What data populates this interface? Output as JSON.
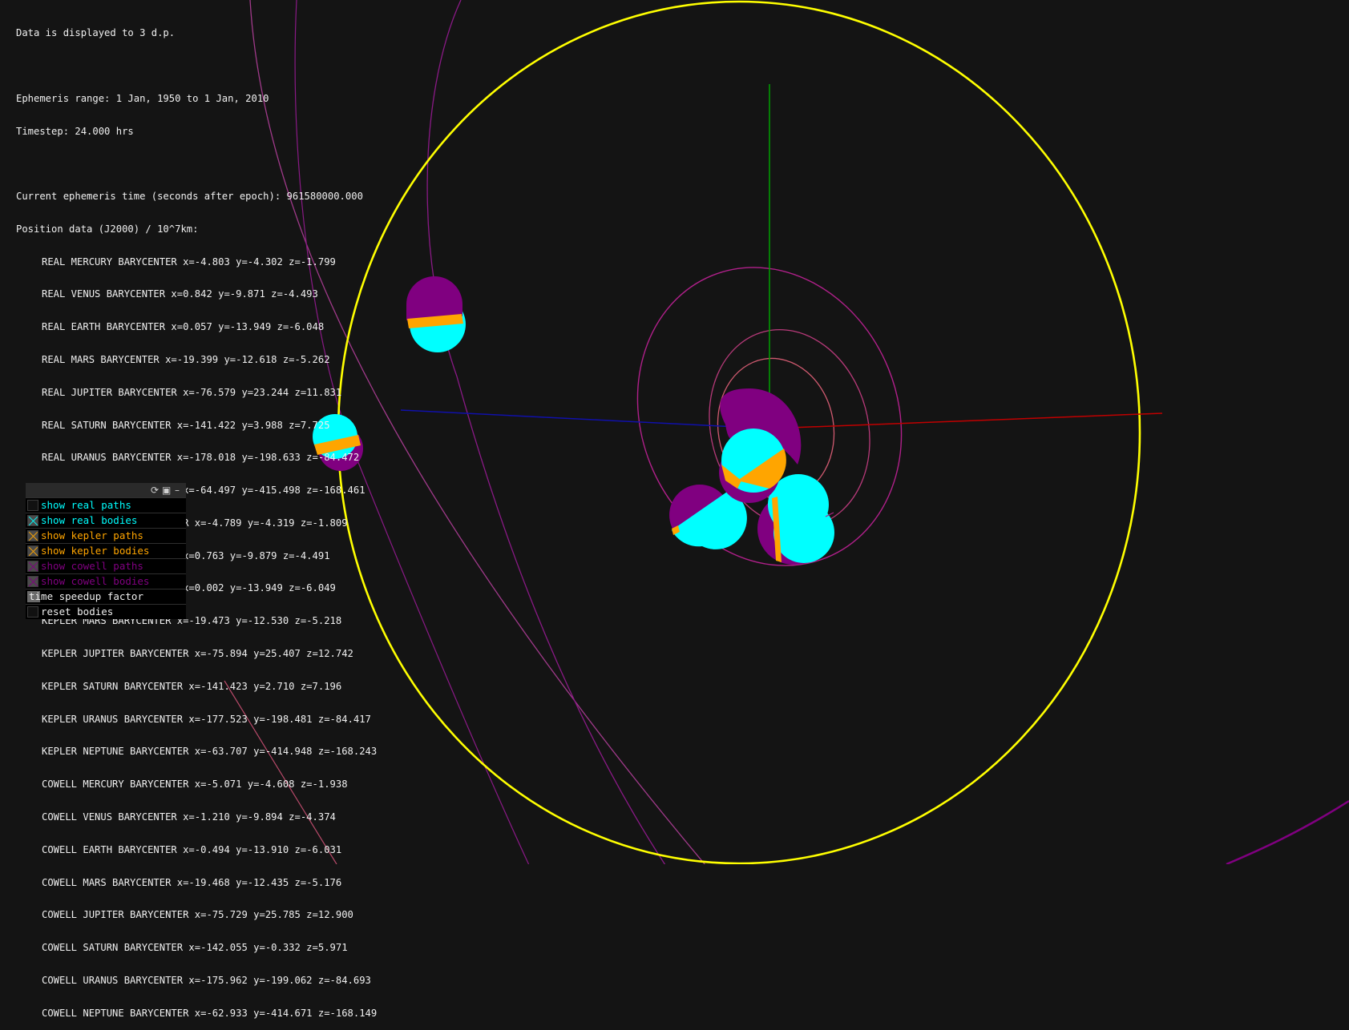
{
  "overlay": {
    "precision": "Data is displayed to 3 d.p.",
    "ephemeris_range": "Ephemeris range: 1 Jan, 1950 to 1 Jan, 2010",
    "timestep": "Timestep: 24.000 hrs",
    "current_time": "Current ephemeris time (seconds after epoch): 961580000.000",
    "position_header": "Position data (J2000) / 10^7km:",
    "positions": [
      "REAL MERCURY BARYCENTER x=-4.803 y=-4.302 z=-1.799",
      "REAL VENUS BARYCENTER x=0.842 y=-9.871 z=-4.493",
      "REAL EARTH BARYCENTER x=0.057 y=-13.949 z=-6.048",
      "REAL MARS BARYCENTER x=-19.399 y=-12.618 z=-5.262",
      "REAL JUPITER BARYCENTER x=-76.579 y=23.244 z=11.831",
      "REAL SATURN BARYCENTER x=-141.422 y=3.988 z=7.725",
      "REAL URANUS BARYCENTER x=-178.018 y=-198.633 z=-84.472",
      "REAL NEPTUNE BARYCENTER x=-64.497 y=-415.498 z=-168.461",
      "KEPLER MERCURY BARYCENTER x=-4.789 y=-4.319 z=-1.809",
      "KEPLER VENUS BARYCENTER x=0.763 y=-9.879 z=-4.491",
      "KEPLER EARTH BARYCENTER x=0.002 y=-13.949 z=-6.049",
      "KEPLER MARS BARYCENTER x=-19.473 y=-12.530 z=-5.218",
      "KEPLER JUPITER BARYCENTER x=-75.894 y=25.407 z=12.742",
      "KEPLER SATURN BARYCENTER x=-141.423 y=2.710 z=7.196",
      "KEPLER URANUS BARYCENTER x=-177.523 y=-198.481 z=-84.417",
      "KEPLER NEPTUNE BARYCENTER x=-63.707 y=-414.948 z=-168.243",
      "COWELL MERCURY BARYCENTER x=-5.071 y=-4.608 z=-1.938",
      "COWELL VENUS BARYCENTER x=-1.210 y=-9.894 z=-4.374",
      "COWELL EARTH BARYCENTER x=-0.494 y=-13.910 z=-6.031",
      "COWELL MARS BARYCENTER x=-19.468 y=-12.435 z=-5.176",
      "COWELL JUPITER BARYCENTER x=-75.729 y=25.785 z=12.900",
      "COWELL SATURN BARYCENTER x=-142.055 y=-0.332 z=5.971",
      "COWELL URANUS BARYCENTER x=-175.962 y=-199.062 z=-84.693",
      "COWELL NEPTUNE BARYCENTER x=-62.933 y=-414.671 z=-168.149"
    ]
  },
  "gui": {
    "controls": [
      {
        "type": "checkbox",
        "label": "show real paths",
        "checked": false,
        "color": "#00ffff",
        "name": "show-real-paths-toggle"
      },
      {
        "type": "checkbox",
        "label": "show real bodies",
        "checked": true,
        "color": "#00ffff",
        "name": "show-real-bodies-toggle"
      },
      {
        "type": "checkbox",
        "label": "show kepler paths",
        "checked": true,
        "color": "#ffa500",
        "name": "show-kepler-paths-toggle"
      },
      {
        "type": "checkbox",
        "label": "show kepler bodies",
        "checked": true,
        "color": "#ffa500",
        "name": "show-kepler-bodies-toggle"
      },
      {
        "type": "checkbox",
        "label": "show cowell paths",
        "checked": true,
        "color": "#800080",
        "name": "show-cowell-paths-toggle"
      },
      {
        "type": "checkbox",
        "label": "show cowell bodies",
        "checked": true,
        "color": "#800080",
        "name": "show-cowell-bodies-toggle"
      },
      {
        "type": "slider",
        "label": "time speedup factor",
        "color": "#f0f0f0",
        "name": "time-speedup-slider"
      },
      {
        "type": "button",
        "label": "reset bodies",
        "color": "#f0f0f0",
        "name": "reset-bodies-button"
      }
    ],
    "icons": [
      "refresh-icon",
      "save-icon",
      "minimize-icon"
    ]
  },
  "colors": {
    "background": "#141414",
    "real": "#00ffff",
    "kepler": "#ffa500",
    "cowell": "#800080",
    "orbit_outer": "#ffff00",
    "axis_x": "#cc0000",
    "axis_y": "#00aa00",
    "axis_z": "#0000aa"
  }
}
